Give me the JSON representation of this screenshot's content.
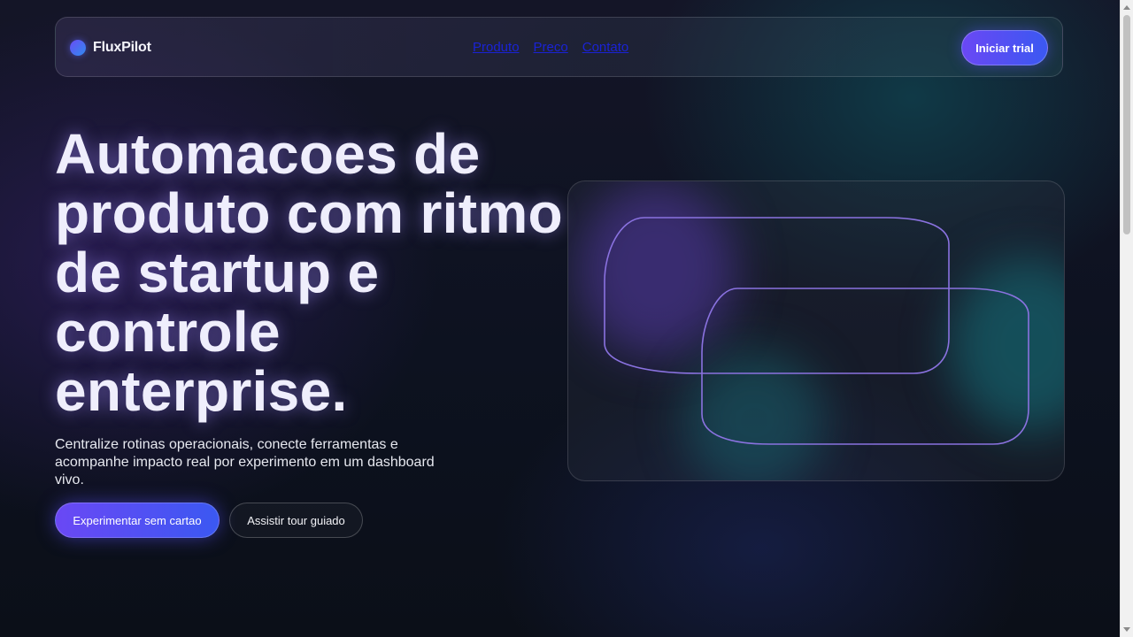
{
  "brand": {
    "name": "FluxPilot",
    "logo_icon": "gradient-dot-icon",
    "logo_colors": [
      "#6a4cf5",
      "#2f8cf0"
    ]
  },
  "nav": {
    "links": [
      "Produto",
      "Preco",
      "Contato"
    ],
    "cta_label": "Iniciar trial"
  },
  "hero": {
    "title": "Automacoes de produto com ritmo de startup e controle enterprise.",
    "subtitle": "Centralize rotinas operacionais, conecte ferramentas e acompanhe impacto real por experimento em um dashboard vivo.",
    "primary_cta": "Experimentar sem cartao",
    "secondary_cta": "Assistir tour guiado"
  },
  "colors": {
    "accent": "#6a48f4",
    "accent_secondary": "#3b58f2",
    "background": "#0c1119",
    "link": "#1a22d6",
    "visual_stroke": "#8a72e0"
  }
}
